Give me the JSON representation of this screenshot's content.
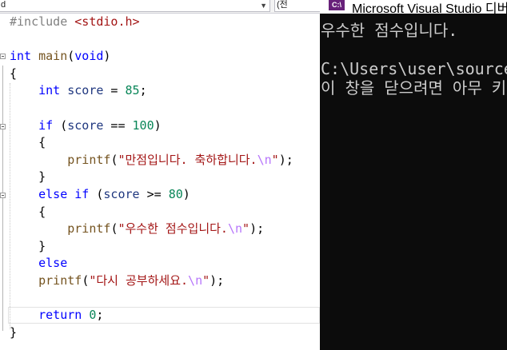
{
  "editor": {
    "dropdown_left": "d",
    "dropdown_right": "(전",
    "code_lines": [
      {
        "tokens": [
          {
            "t": "#include ",
            "c": "pp"
          },
          {
            "t": "<stdio.h>",
            "c": "hd"
          }
        ]
      },
      {
        "tokens": []
      },
      {
        "tokens": [
          {
            "t": "int",
            "c": "kw"
          },
          {
            "t": " ",
            "c": "op"
          },
          {
            "t": "main",
            "c": "fn"
          },
          {
            "t": "(",
            "c": "op"
          },
          {
            "t": "void",
            "c": "kw"
          },
          {
            "t": ")",
            "c": "op"
          }
        ]
      },
      {
        "tokens": [
          {
            "t": "{",
            "c": "op"
          }
        ]
      },
      {
        "tokens": [
          {
            "t": "    ",
            "c": "op"
          },
          {
            "t": "int",
            "c": "kw"
          },
          {
            "t": " ",
            "c": "op"
          },
          {
            "t": "score",
            "c": "vr"
          },
          {
            "t": " = ",
            "c": "op"
          },
          {
            "t": "85",
            "c": "nm"
          },
          {
            "t": ";",
            "c": "op"
          }
        ]
      },
      {
        "tokens": []
      },
      {
        "tokens": [
          {
            "t": "    ",
            "c": "op"
          },
          {
            "t": "if",
            "c": "kw"
          },
          {
            "t": " (",
            "c": "op"
          },
          {
            "t": "score",
            "c": "vr"
          },
          {
            "t": " == ",
            "c": "op"
          },
          {
            "t": "100",
            "c": "nm"
          },
          {
            "t": ")",
            "c": "op"
          }
        ]
      },
      {
        "tokens": [
          {
            "t": "    {",
            "c": "op"
          }
        ]
      },
      {
        "tokens": [
          {
            "t": "        ",
            "c": "op"
          },
          {
            "t": "printf",
            "c": "fn"
          },
          {
            "t": "(",
            "c": "op"
          },
          {
            "t": "\"만점입니다. 축하합니다.",
            "c": "st"
          },
          {
            "t": "\\n",
            "c": "es"
          },
          {
            "t": "\"",
            "c": "st"
          },
          {
            "t": ");",
            "c": "op"
          }
        ]
      },
      {
        "tokens": [
          {
            "t": "    }",
            "c": "op"
          }
        ]
      },
      {
        "tokens": [
          {
            "t": "    ",
            "c": "op"
          },
          {
            "t": "else if",
            "c": "kw"
          },
          {
            "t": " (",
            "c": "op"
          },
          {
            "t": "score",
            "c": "vr"
          },
          {
            "t": " >= ",
            "c": "op"
          },
          {
            "t": "80",
            "c": "nm"
          },
          {
            "t": ")",
            "c": "op"
          }
        ]
      },
      {
        "tokens": [
          {
            "t": "    {",
            "c": "op"
          }
        ]
      },
      {
        "tokens": [
          {
            "t": "        ",
            "c": "op"
          },
          {
            "t": "printf",
            "c": "fn"
          },
          {
            "t": "(",
            "c": "op"
          },
          {
            "t": "\"우수한 점수입니다.",
            "c": "st"
          },
          {
            "t": "\\n",
            "c": "es"
          },
          {
            "t": "\"",
            "c": "st"
          },
          {
            "t": ");",
            "c": "op"
          }
        ]
      },
      {
        "tokens": [
          {
            "t": "    }",
            "c": "op"
          }
        ]
      },
      {
        "tokens": [
          {
            "t": "    ",
            "c": "op"
          },
          {
            "t": "else",
            "c": "kw"
          }
        ]
      },
      {
        "tokens": [
          {
            "t": "    ",
            "c": "op"
          },
          {
            "t": "printf",
            "c": "fn"
          },
          {
            "t": "(",
            "c": "op"
          },
          {
            "t": "\"다시 공부하세요.",
            "c": "st"
          },
          {
            "t": "\\n",
            "c": "es"
          },
          {
            "t": "\"",
            "c": "st"
          },
          {
            "t": ");",
            "c": "op"
          }
        ]
      },
      {
        "tokens": []
      },
      {
        "tokens": [
          {
            "t": "    ",
            "c": "op"
          },
          {
            "t": "return",
            "c": "kw"
          },
          {
            "t": " ",
            "c": "op"
          },
          {
            "t": "0",
            "c": "nm"
          },
          {
            "t": ";",
            "c": "op"
          }
        ]
      },
      {
        "tokens": [
          {
            "t": "}",
            "c": "op"
          }
        ]
      }
    ]
  },
  "console": {
    "icon_label": "C:\\",
    "title": "Microsoft Visual Studio 디버그 콘솔",
    "lines": [
      "우수한 점수입니다.",
      "",
      "C:\\Users\\user\\source\\repos",
      "이 창을 닫으려면 아무 키나 누르세요..."
    ]
  },
  "colors": {
    "keyword": "#0000ff",
    "string": "#a31515",
    "number": "#098658",
    "function": "#74531f",
    "variable": "#1f377f",
    "preprocessor": "#808080",
    "escape": "#b776fb",
    "console_bg": "#0c0c0c",
    "console_text": "#cccccc",
    "vs_purple": "#68217a"
  }
}
